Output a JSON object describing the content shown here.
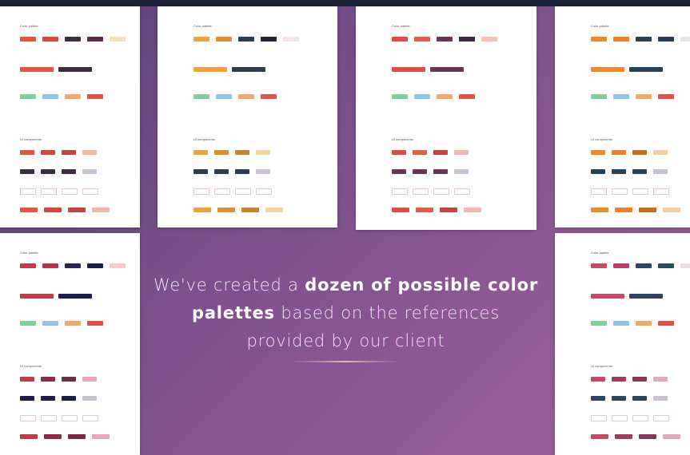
{
  "headline": {
    "line1_pre": "We've created a ",
    "line1_bold": "dozen of possible color",
    "line2_bold": "palettes",
    "line2_post": " based on the references",
    "line3": "provided by our client"
  },
  "card_titles": {
    "color_palette": "Color palette",
    "ui_components": "UI components"
  },
  "cards": [
    {
      "id": "c1",
      "swatches": [
        "#e8533e",
        "#d9453c",
        "#3a2f3d",
        "#5b2a45",
        "#f6e0b5"
      ],
      "accents": [
        "#e8533e",
        "#3a2f3d"
      ],
      "ui": [
        "#e8533e",
        "#d9453c",
        "#c8423f",
        "#f0b6a8"
      ]
    },
    {
      "id": "c2",
      "swatches": [
        "#f0a33a",
        "#e08f2f",
        "#2e3a4d",
        "#1e2636",
        "#f3e3e8"
      ],
      "accents": [
        "#f0a33a",
        "#2e3a4d"
      ],
      "ui": [
        "#f0a33a",
        "#e08f2f",
        "#c9822e",
        "#f5d59a"
      ]
    },
    {
      "id": "c3",
      "swatches": [
        "#e04a48",
        "#e25b45",
        "#6b3555",
        "#3b2a3e",
        "#f6c2b8"
      ],
      "accents": [
        "#e04a48",
        "#6b3555"
      ],
      "ui": [
        "#e04a48",
        "#e25b45",
        "#c5423f",
        "#f0b6b3"
      ]
    },
    {
      "id": "c4",
      "swatches": [
        "#f0882d",
        "#ef7f2c",
        "#27435a",
        "#2b3c52",
        "#dfe7ea"
      ],
      "accents": [
        "#f0882d",
        "#27435a"
      ],
      "ui": [
        "#f0882d",
        "#ef7f2c",
        "#c96d1f",
        "#f5cba0"
      ]
    },
    {
      "id": "c5",
      "swatches": [
        "#c53a4a",
        "#b62f45",
        "#2d2350",
        "#1d1c4a",
        "#f6c8d0"
      ],
      "accents": [
        "#c53a4a",
        "#1d1c4a"
      ],
      "ui": [
        "#c53a4a",
        "#8e2b45",
        "#7a2741",
        "#e8a6b6"
      ]
    },
    {
      "id": "c6",
      "swatches": [
        "#c94a66",
        "#b94064",
        "#2d4560",
        "#2a4b5e",
        "#e9e0e6"
      ],
      "accents": [
        "#c94a66",
        "#2d4560"
      ],
      "ui": [
        "#c94a66",
        "#9d3c5e",
        "#8a3659",
        "#e4a8bb"
      ]
    }
  ]
}
